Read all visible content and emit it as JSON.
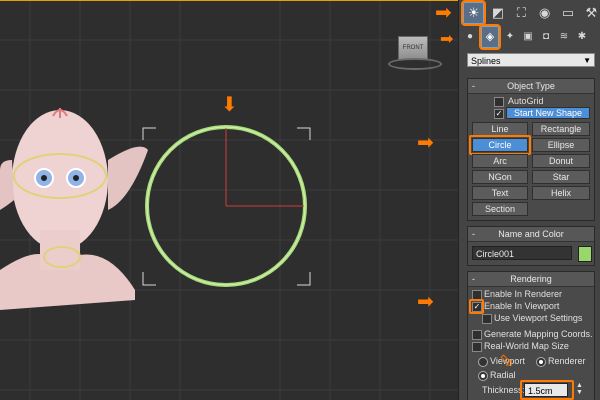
{
  "viewcube_label": "FRONT",
  "panel": {
    "tabs": [
      {
        "name": "create-tab",
        "icon": "☀"
      },
      {
        "name": "modify-tab",
        "icon": "◩"
      },
      {
        "name": "hierarchy-tab",
        "icon": "⛶"
      },
      {
        "name": "motion-tab",
        "icon": "◉"
      },
      {
        "name": "display-tab",
        "icon": "▭"
      },
      {
        "name": "utilities-tab",
        "icon": "⚒"
      }
    ],
    "subtabs": [
      {
        "name": "geometry-subtab",
        "icon": "●"
      },
      {
        "name": "shapes-subtab",
        "icon": "◈"
      },
      {
        "name": "lights-subtab",
        "icon": "✦"
      },
      {
        "name": "cameras-subtab",
        "icon": "▣"
      },
      {
        "name": "helpers-subtab",
        "icon": "◘"
      },
      {
        "name": "spacewarps-subtab",
        "icon": "≋"
      },
      {
        "name": "systems-subtab",
        "icon": "✱"
      }
    ],
    "category": "Splines",
    "object_type": {
      "title": "Object Type",
      "autogrid": "AutoGrid",
      "start_new_shape": "Start New Shape",
      "buttons": [
        "Line",
        "Rectangle",
        "Circle",
        "Ellipse",
        "Arc",
        "Donut",
        "NGon",
        "Star",
        "Text",
        "Helix",
        "Section"
      ],
      "selected": "Circle"
    },
    "name_color": {
      "title": "Name and Color",
      "name": "Circle001",
      "color": "#98d86a"
    },
    "rendering": {
      "title": "Rendering",
      "enable_in_renderer": "Enable In Renderer",
      "enable_in_viewport": "Enable In Viewport",
      "use_viewport_settings": "Use Viewport Settings",
      "generate_mapping": "Generate Mapping Coords.",
      "real_world_map": "Real-World Map Size",
      "viewport_radio": "Viewport",
      "renderer_radio": "Renderer",
      "radial": "Radial",
      "thickness_label": "Thickness:",
      "thickness_value": "1.5cm"
    }
  }
}
